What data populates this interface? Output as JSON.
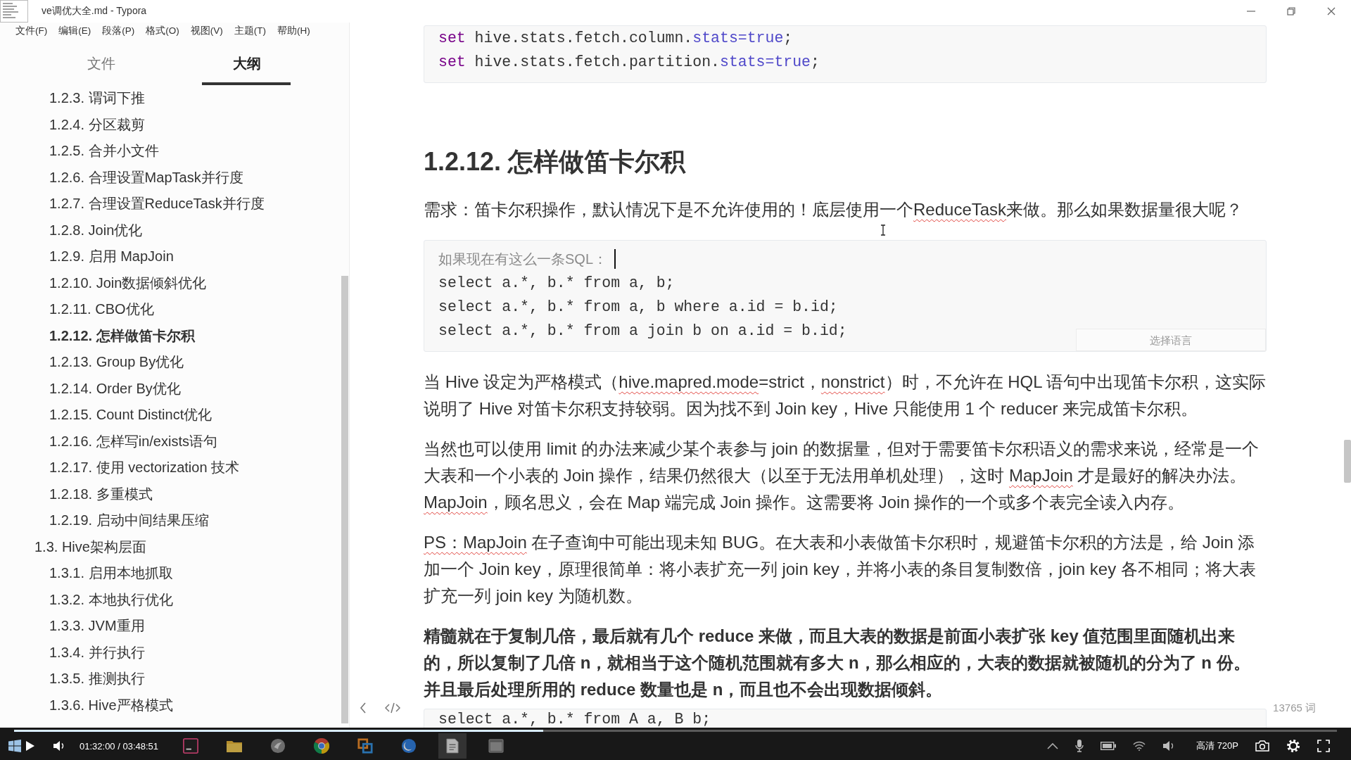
{
  "window": {
    "title": "ve调优大全.md - Typora"
  },
  "menu": [
    "文件(F)",
    "编辑(E)",
    "段落(P)",
    "格式(O)",
    "视图(V)",
    "主题(T)",
    "帮助(H)"
  ],
  "sidebar": {
    "tabs": [
      {
        "label": "文件",
        "selected": false
      },
      {
        "label": "大纲",
        "selected": true
      }
    ],
    "outline": [
      {
        "children": [
          {
            "label": "1.2.3. 谓词下推",
            "selected": false
          },
          {
            "label": "1.2.4. 分区裁剪",
            "selected": false
          },
          {
            "label": "1.2.5. 合并小文件",
            "selected": false
          },
          {
            "label": "1.2.6. 合理设置MapTask并行度",
            "selected": false
          },
          {
            "label": "1.2.7. 合理设置ReduceTask并行度",
            "selected": false
          },
          {
            "label": "1.2.8. Join优化",
            "selected": false
          },
          {
            "label": "1.2.9. 启用 MapJoin",
            "selected": false
          },
          {
            "label": "1.2.10. Join数据倾斜优化",
            "selected": false
          },
          {
            "label": "1.2.11. CBO优化",
            "selected": false
          },
          {
            "label": "1.2.12. 怎样做笛卡尔积",
            "selected": true
          },
          {
            "label": "1.2.13. Group By优化",
            "selected": false
          },
          {
            "label": "1.2.14. Order By优化",
            "selected": false
          },
          {
            "label": "1.2.15. Count Distinct优化",
            "selected": false
          },
          {
            "label": "1.2.16. 怎样写in/exists语句",
            "selected": false
          },
          {
            "label": "1.2.17. 使用 vectorization 技术",
            "selected": false
          },
          {
            "label": "1.2.18. 多重模式",
            "selected": false
          },
          {
            "label": "1.2.19. 启动中间结果压缩",
            "selected": false
          }
        ]
      },
      {
        "label": "1.3. Hive架构层面",
        "selected": false,
        "children": [
          {
            "label": "1.3.1. 启用本地抓取",
            "selected": false
          },
          {
            "label": "1.3.2. 本地执行优化",
            "selected": false
          },
          {
            "label": "1.3.3. JVM重用",
            "selected": false
          },
          {
            "label": "1.3.4. 并行执行",
            "selected": false
          },
          {
            "label": "1.3.5. 推测执行",
            "selected": false
          },
          {
            "label": "1.3.6. Hive严格模式",
            "selected": false
          }
        ]
      }
    ]
  },
  "document": {
    "blocks": [
      {
        "kind": "code",
        "lines": [
          {
            "tokens": [
              {
                "text": "set",
                "kind": "keyword"
              },
              {
                "text": " hive.stats.fetch.column.",
                "kind": "plain"
              },
              {
                "text": "stats=true",
                "kind": "property"
              },
              {
                "text": ";",
                "kind": "plain"
              }
            ],
            "caret": false
          },
          {
            "tokens": [
              {
                "text": "set",
                "kind": "keyword"
              },
              {
                "text": " hive.stats.fetch.partition.",
                "kind": "plain"
              },
              {
                "text": "stats=true",
                "kind": "property"
              },
              {
                "text": ";",
                "kind": "plain"
              }
            ],
            "caret": false
          }
        ]
      },
      {
        "kind": "heading",
        "text": "1.2.12. 怎样做笛卡尔积"
      },
      {
        "kind": "paragraph",
        "bold": false,
        "segments": [
          {
            "text": "需求：笛卡尔积操作，默认情况下是不允许使用的！底层使用一个",
            "misspelled": false
          },
          {
            "text": "ReduceTask",
            "misspelled": true
          },
          {
            "text": "来做。那么如果数据量很大呢？",
            "misspelled": false
          }
        ]
      },
      {
        "kind": "code",
        "lines": [
          {
            "tokens": [
              {
                "text": "如果现在有这么一条SQL：",
                "kind": "comment"
              }
            ],
            "caret": true
          },
          {
            "tokens": [
              {
                "text": "select a.*, b.* from a, b;",
                "kind": "plain"
              }
            ],
            "caret": false
          },
          {
            "tokens": [
              {
                "text": "select a.*, b.* from a, b where a.id = b.id;",
                "kind": "plain"
              }
            ],
            "caret": false
          },
          {
            "tokens": [
              {
                "text": "select a.*, b.* from a join b on a.id = b.id;",
                "kind": "plain"
              }
            ],
            "caret": false
          }
        ],
        "language_picker": {
          "placeholder": "选择语言"
        }
      },
      {
        "kind": "paragraph",
        "bold": false,
        "segments": [
          {
            "text": "当 Hive 设定为严格模式（",
            "misspelled": false
          },
          {
            "text": "hive.mapred.mode",
            "misspelled": true
          },
          {
            "text": "=strict，",
            "misspelled": false
          },
          {
            "text": "nonstrict",
            "misspelled": true
          },
          {
            "text": "）时，不允许在 HQL 语句中出现笛卡尔积，这实际说明了 Hive 对笛卡尔积支持较弱。因为找不到 Join key，Hive 只能使用 1 个 reducer 来完成笛卡尔积。",
            "misspelled": false
          }
        ]
      },
      {
        "kind": "paragraph",
        "bold": false,
        "segments": [
          {
            "text": "当然也可以使用 limit 的办法来减少某个表参与 join 的数据量，但对于需要笛卡尔积语义的需求来说，经常是一个大表和一个小表的 Join 操作，结果仍然很大（以至于无法用单机处理），这时 ",
            "misspelled": false
          },
          {
            "text": "MapJoin",
            "misspelled": true
          },
          {
            "text": " 才是最好的解决办法。",
            "misspelled": false
          },
          {
            "text": "MapJoin",
            "misspelled": true
          },
          {
            "text": "，顾名思义，会在 Map 端完成 Join 操作。这需要将 Join 操作的一个或多个表完全读入内存。",
            "misspelled": false
          }
        ]
      },
      {
        "kind": "paragraph",
        "bold": false,
        "segments": [
          {
            "text": "PS：MapJoin",
            "misspelled": true
          },
          {
            "text": " 在子查询中可能出现未知 BUG。在大表和小表做笛卡尔积时，规避笛卡尔积的方法是，给 Join 添加一个 Join key，原理很简单：将小表扩充一列 join key，并将小表的条目复制数倍，join key 各不相同；将大表扩充一列 join key 为随机数。",
            "misspelled": false
          }
        ]
      },
      {
        "kind": "paragraph",
        "bold": true,
        "segments": [
          {
            "text": "精髓就在于复制几倍，最后就有几个 reduce 来做，而且大表的数据是前面小表扩张 key 值范围里面随机出来的，所以复制了几倍 n，就相当于这个随机范围就有多大 n，那么相应的，大表的数据就被随机的分为了 n 份。并且最后处理所用的 reduce 数量也是 n，而且也不会出现数据倾斜。",
            "misspelled": false
          }
        ]
      },
      {
        "kind": "code",
        "lines": [
          {
            "tokens": [
              {
                "text": "select a.*, b.* from A a, B b;",
                "kind": "plain"
              }
            ],
            "caret": false
          }
        ]
      }
    ]
  },
  "status_bar": {
    "word_count": "13765 词"
  },
  "player": {
    "progress": {
      "level": 0.4
    },
    "time": "01:32:00 / 03:48:51",
    "quality": "高清 720P"
  },
  "taskbar": {
    "apps": [
      {
        "kind": "square-app",
        "selected": false
      },
      {
        "kind": "folder",
        "selected": false
      },
      {
        "kind": "round-app",
        "selected": false
      },
      {
        "kind": "tricolor-circle",
        "selected": false
      },
      {
        "kind": "overlapping-squares",
        "selected": false
      },
      {
        "kind": "disc",
        "selected": false
      },
      {
        "kind": "document",
        "selected": true
      },
      {
        "kind": "window",
        "selected": false
      }
    ]
  }
}
